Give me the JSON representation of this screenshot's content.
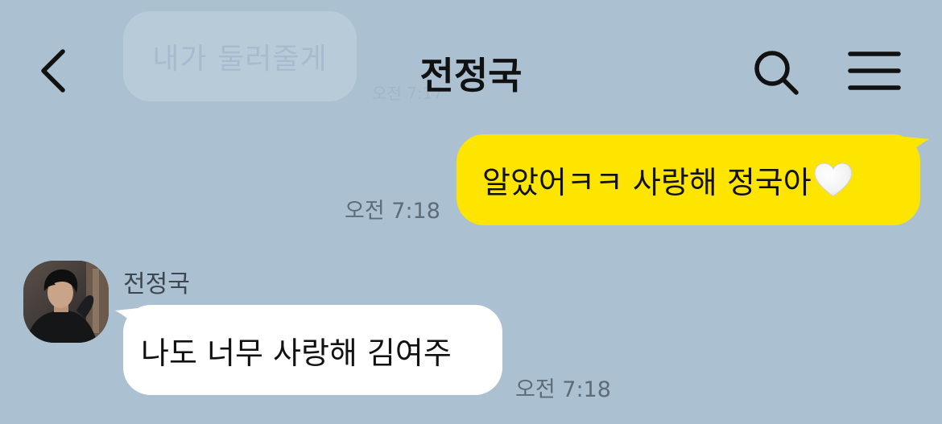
{
  "chat": {
    "title": "전정국",
    "background_color": "#abc1d1"
  },
  "previous_message": {
    "text": "내가 둘러줄게",
    "time": "오전 7:17"
  },
  "sent_message": {
    "text": "알았어ㅋㅋ 사랑해 정국아",
    "emoji": "white-heart-icon",
    "time": "오전 7:18",
    "bubble_color": "#fee500"
  },
  "received_message": {
    "sender": "전정국",
    "text": "나도 너무 사랑해 김여주",
    "time": "오전 7:18",
    "bubble_color": "#ffffff"
  },
  "icons": {
    "back": "chevron-left-icon",
    "search": "search-icon",
    "menu": "hamburger-menu-icon"
  }
}
